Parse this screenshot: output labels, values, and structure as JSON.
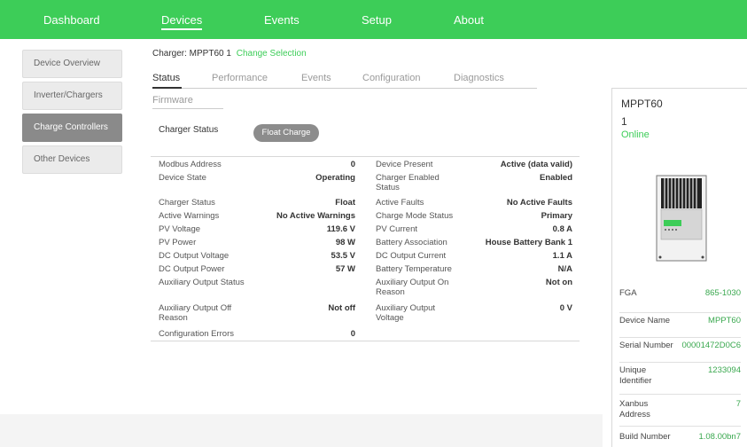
{
  "nav": {
    "dashboard": "Dashboard",
    "devices": "Devices",
    "events": "Events",
    "setup": "Setup",
    "about": "About"
  },
  "sidebar": {
    "items": [
      {
        "label": "Device Overview"
      },
      {
        "label": "Inverter/Chargers"
      },
      {
        "label": "Charge Controllers"
      },
      {
        "label": "Other Devices"
      }
    ]
  },
  "charger": {
    "title": "Charger: MPPT60 1",
    "change_link": "Change Selection"
  },
  "tabs": {
    "status": "Status",
    "performance": "Performance",
    "events": "Events",
    "configuration": "Configuration",
    "diagnostics": "Diagnostics",
    "firmware": "Firmware"
  },
  "status": {
    "label": "Charger Status",
    "pill": "Float Charge"
  },
  "table": {
    "left": [
      {
        "label": "Modbus Address",
        "value": "0"
      },
      {
        "label": "Device State",
        "value": "Operating"
      },
      {
        "label": "Charger Status",
        "value": "Float"
      },
      {
        "label": "Active Warnings",
        "value": "No Active Warnings"
      },
      {
        "label": "PV Voltage",
        "value": "119.6 V"
      },
      {
        "label": "PV Power",
        "value": "98 W"
      },
      {
        "label": "DC Output Voltage",
        "value": "53.5 V"
      },
      {
        "label": "DC Output Power",
        "value": "57 W"
      },
      {
        "label": "Auxiliary Output Status",
        "value": ""
      },
      {
        "label": "Auxiliary Output Off Reason",
        "value": "Not off"
      },
      {
        "label": "Configuration Errors",
        "value": "0"
      }
    ],
    "right": [
      {
        "label": "Device Present",
        "value": "Active (data valid)"
      },
      {
        "label": "Charger Enabled Status",
        "value": "Enabled"
      },
      {
        "label": "Active Faults",
        "value": "No Active Faults"
      },
      {
        "label": "Charge Mode Status",
        "value": "Primary"
      },
      {
        "label": "PV Current",
        "value": "0.8 A"
      },
      {
        "label": "Battery Association",
        "value": "House Battery Bank 1"
      },
      {
        "label": "DC Output Current",
        "value": "1.1 A"
      },
      {
        "label": "Battery Temperature",
        "value": "N/A"
      },
      {
        "label": "Auxiliary Output On Reason",
        "value": "Not on"
      },
      {
        "label": "Auxiliary Output Voltage",
        "value": "0 V"
      }
    ]
  },
  "panel": {
    "name": "MPPT60",
    "number": "1",
    "status": "Online",
    "details": [
      {
        "key": "FGA",
        "value": "865-1030"
      },
      {
        "key": "Device Name",
        "value": "MPPT60"
      },
      {
        "key": "Serial Number",
        "value": "00001472D0C6"
      },
      {
        "key": "Unique Identifier",
        "value": "1233094"
      },
      {
        "key": "Xanbus Address",
        "value": "7"
      },
      {
        "key": "Build Number",
        "value": "1.08.00bn7"
      }
    ]
  },
  "colors": {
    "accent": "#3dcd58",
    "sidebar_active": "#8a8a8a",
    "pill": "#8c8c8c"
  }
}
